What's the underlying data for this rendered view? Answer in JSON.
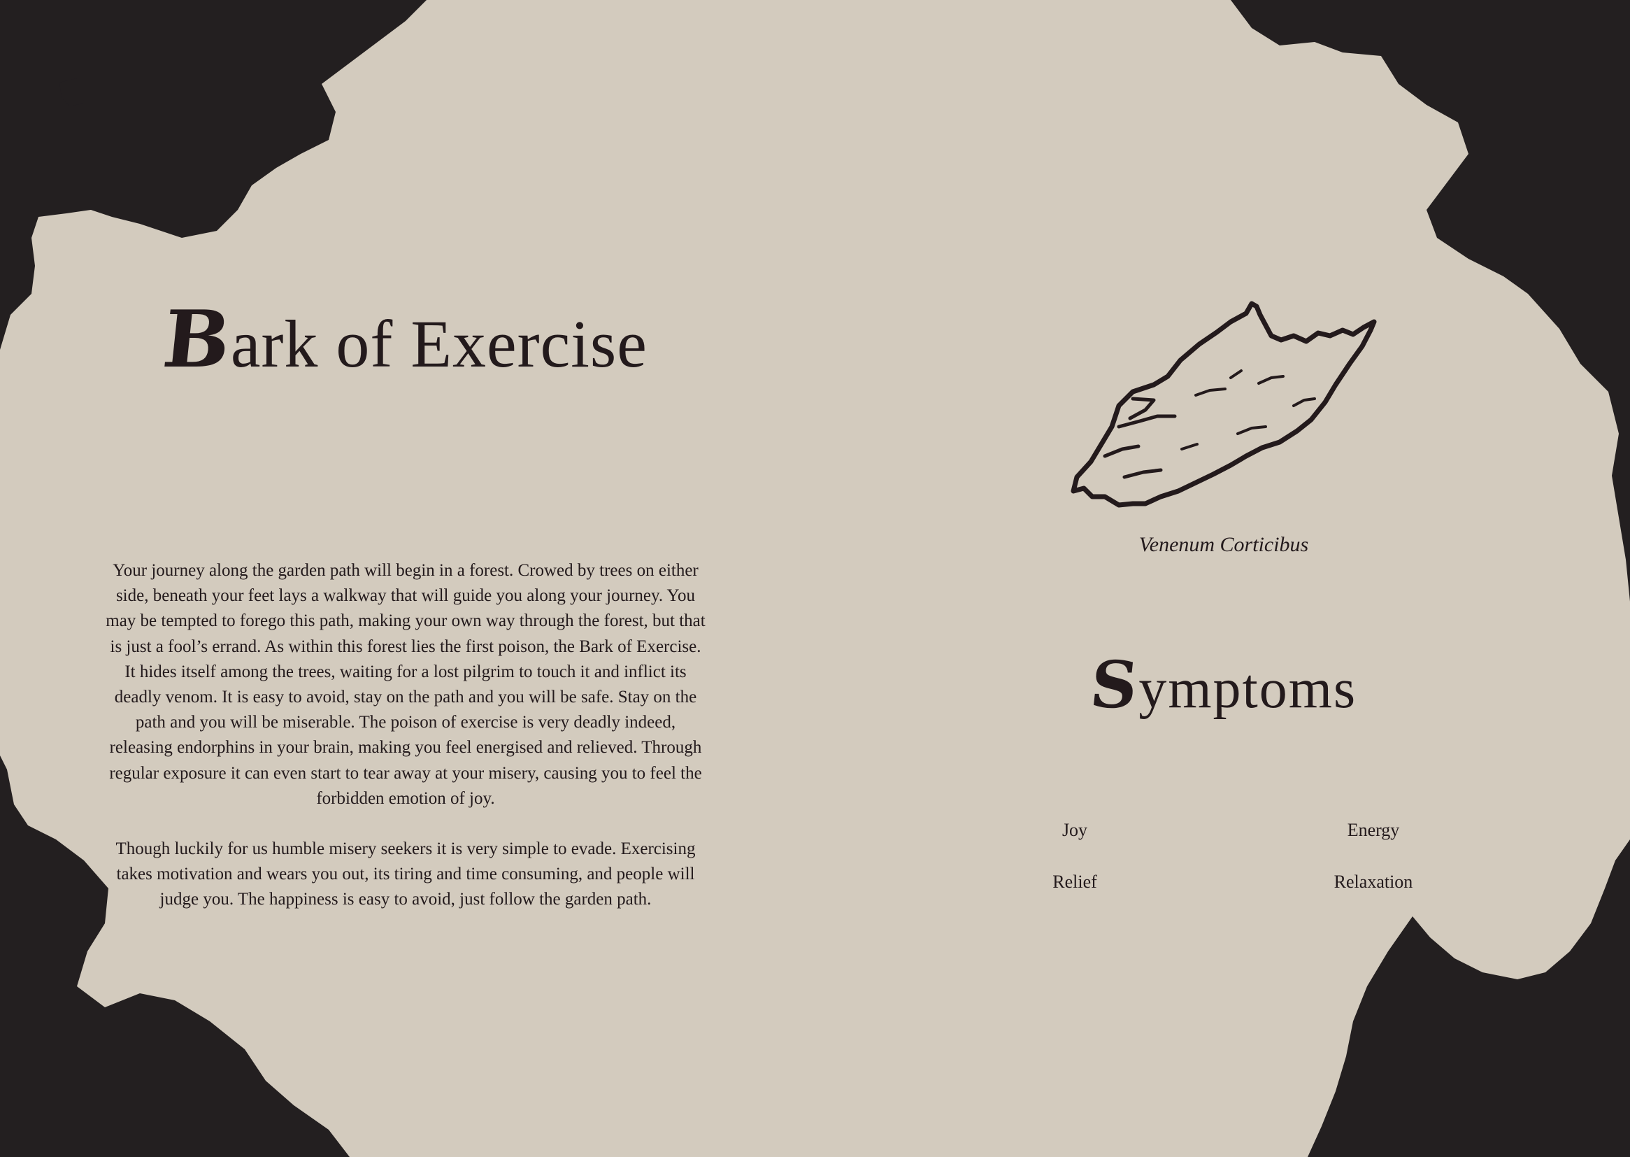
{
  "page": {
    "title_initial": "B",
    "title_rest": "ark of Exercise",
    "paragraphs": [
      "Your journey along the garden path will begin in a forest. Crowed by trees on either side, beneath your feet lays a walkway that will guide you along your journey. You may be tempted to forego this path, making your own way through the forest, but that is just a fool’s errand. As within this forest lies the first poison, the Bark of Exercise. It hides itself among the trees, waiting for a lost pilgrim to touch it and inflict its deadly venom. It is easy to avoid, stay on the path and you will be safe. Stay on the path and you will be miserable. The poison of exercise is very deadly indeed, releasing endorphins in your brain, making you feel energised and relieved. Through regular exposure it can even start to tear away at your misery, causing you to feel the forbidden emotion of joy.",
      "Though luckily for us humble misery seekers it is very simple to evade. Exercising takes motivation and wears you out, its tiring and time consuming, and people will judge you. The happiness is easy to avoid, just follow the garden path."
    ],
    "caption": "Venenum Corticibus",
    "symptoms_initial": "S",
    "symptoms_rest": "ymptoms",
    "symptoms": [
      "Joy",
      "Energy",
      "Relief",
      "Relaxation"
    ]
  },
  "colors": {
    "background": "#231f20",
    "parchment": "#d3cbbe",
    "ink": "#231a1c"
  },
  "icons": {
    "illustration": "bark-piece-icon"
  }
}
